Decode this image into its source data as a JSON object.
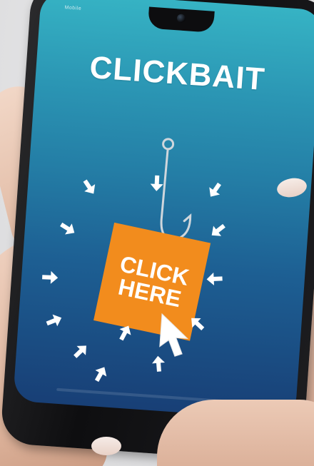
{
  "scene": {
    "description_free": true
  },
  "phone": {
    "headline": "CLICKBAIT",
    "cta_line1": "CLICK",
    "cta_line2": "HERE",
    "status_left": "Mobile",
    "status_right": ""
  },
  "colors": {
    "screen_top": "#36b3c4",
    "screen_bottom": "#183f76",
    "cta_orange": "#f28c1d",
    "headline_white": "#ffffff"
  },
  "icons": {
    "hook": "fishing-hook-icon",
    "pointer": "cursor-pointer-icon",
    "arrows": "arrow-icon"
  }
}
